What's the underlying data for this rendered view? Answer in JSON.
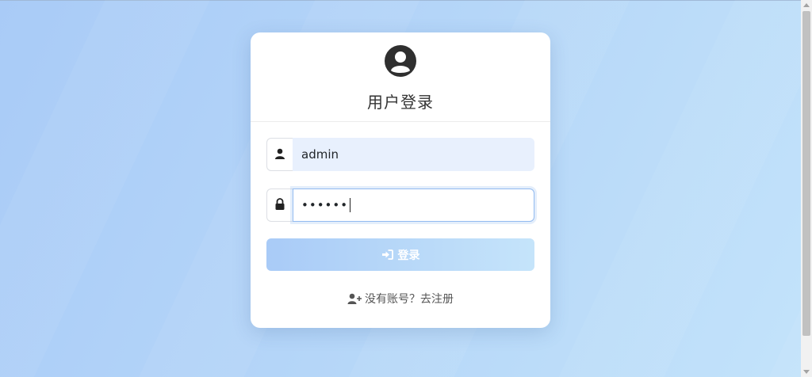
{
  "login": {
    "title": "用户登录",
    "username_value": "admin",
    "password_value": "••••••",
    "login_button": "登录",
    "register_link": "没有账号？去注册"
  },
  "icons": {
    "header": "user-circle-icon",
    "username": "user-icon",
    "password": "lock-icon",
    "login": "sign-in-icon",
    "register": "user-plus-icon"
  },
  "colors": {
    "accent_start": "#a9cbf7",
    "accent_end": "#c5e4fa",
    "focus_border": "#93bbf0",
    "autofill_bg": "#e8f0fd"
  }
}
